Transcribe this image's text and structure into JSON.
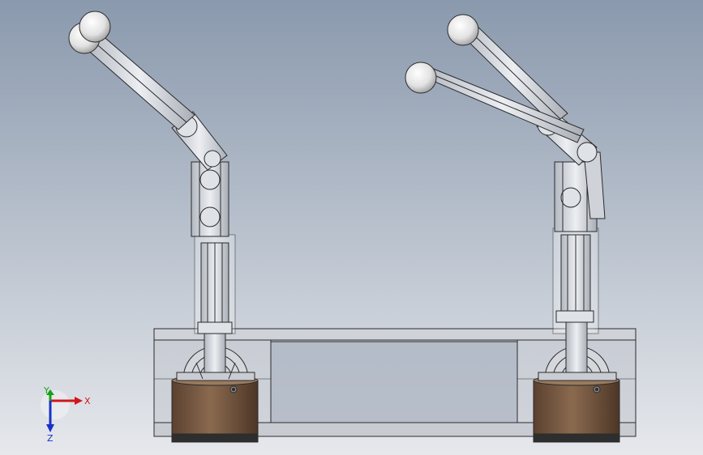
{
  "viewport": {
    "background_top": "#8a99ad",
    "background_bottom": "#e6e8ec"
  },
  "colors": {
    "metal_light": "#e6e9ee",
    "metal_mid": "#c4c9d1",
    "metal_dark": "#8d949e",
    "outline": "#2b2b2b",
    "ball": "#f2f2f2",
    "base_brown": "#7a5a40",
    "base_brown_dark": "#4a3424",
    "frame": "#b9bec6"
  },
  "triad": {
    "x_label": "X",
    "y_label": "Y",
    "z_label": "Z",
    "x_color": "#d01818",
    "y_color": "#18a018",
    "z_color": "#1830c8"
  }
}
